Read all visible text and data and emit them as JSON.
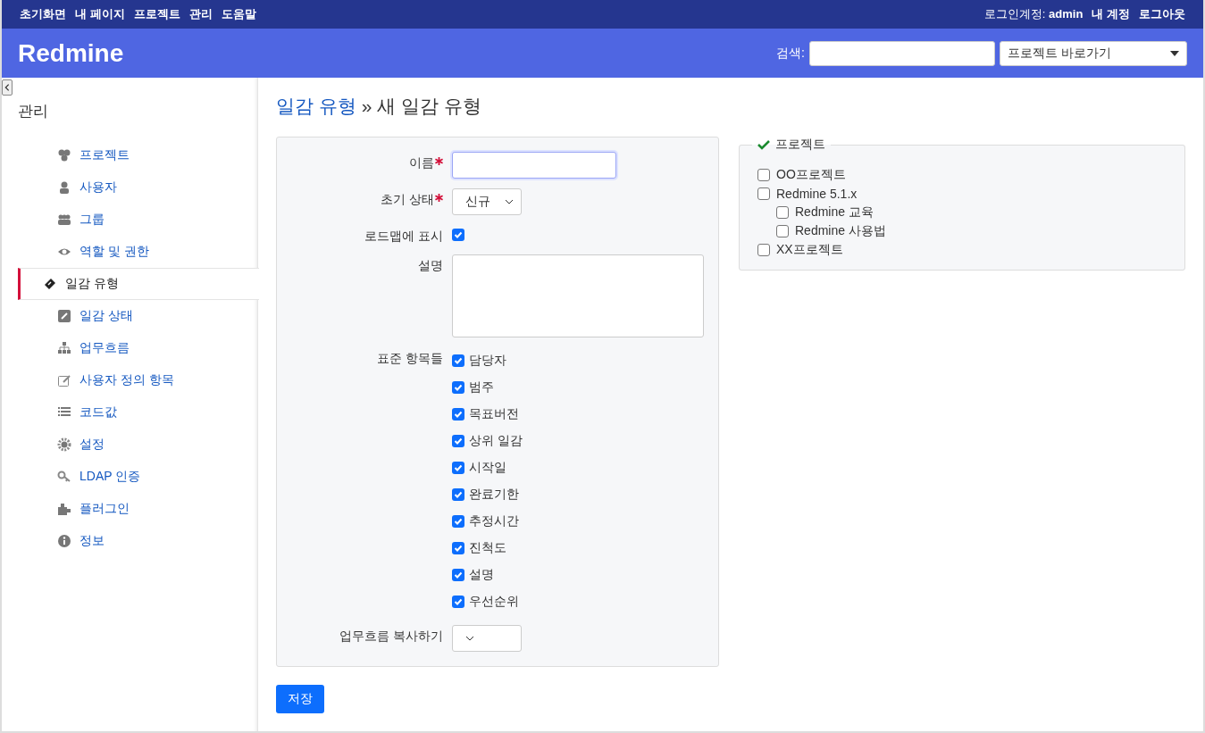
{
  "top_menu": {
    "items": [
      "초기화면",
      "내 페이지",
      "프로젝트",
      "관리",
      "도움말"
    ],
    "login_label": "로그인계정:",
    "login_user": "admin",
    "account_links": [
      "내 계정",
      "로그아웃"
    ]
  },
  "header": {
    "title": "Redmine",
    "search_label": "검색:",
    "project_jump": "프로젝트 바로가기"
  },
  "sidebar": {
    "title": "관리",
    "items": [
      {
        "label": "프로젝트",
        "selected": false
      },
      {
        "label": "사용자",
        "selected": false
      },
      {
        "label": "그룹",
        "selected": false
      },
      {
        "label": "역할 및 권한",
        "selected": false
      },
      {
        "label": "일감 유형",
        "selected": true
      },
      {
        "label": "일감 상태",
        "selected": false
      },
      {
        "label": "업무흐름",
        "selected": false
      },
      {
        "label": "사용자 정의 항목",
        "selected": false
      },
      {
        "label": "코드값",
        "selected": false
      },
      {
        "label": "설정",
        "selected": false
      },
      {
        "label": "LDAP 인증",
        "selected": false
      },
      {
        "label": "플러그인",
        "selected": false
      },
      {
        "label": "정보",
        "selected": false
      }
    ]
  },
  "breadcrumb": {
    "link": "일감 유형",
    "current": "» 새 일감 유형"
  },
  "form": {
    "fields": [
      {
        "kind": "text",
        "label": "이름",
        "required": true
      },
      {
        "kind": "select",
        "label": "초기 상태",
        "required": true,
        "value": "신규"
      },
      {
        "kind": "checkbox",
        "label": "로드맵에 표시",
        "required": false,
        "checked": true
      },
      {
        "kind": "textarea",
        "label": "설명",
        "required": false
      },
      {
        "kind": "checklist",
        "label": "표준 항목들",
        "required": false,
        "items": [
          {
            "label": "담당자",
            "checked": true
          },
          {
            "label": "범주",
            "checked": true
          },
          {
            "label": "목표버전",
            "checked": true
          },
          {
            "label": "상위 일감",
            "checked": true
          },
          {
            "label": "시작일",
            "checked": true
          },
          {
            "label": "완료기한",
            "checked": true
          },
          {
            "label": "추정시간",
            "checked": true
          },
          {
            "label": "진척도",
            "checked": true
          },
          {
            "label": "설명",
            "checked": true
          },
          {
            "label": "우선순위",
            "checked": true
          }
        ]
      },
      {
        "kind": "select",
        "label": "업무흐름 복사하기",
        "required": false
      }
    ]
  },
  "projects": {
    "legend": "프로젝트",
    "items": [
      {
        "label": "OO프로젝트",
        "checked": false
      },
      {
        "label": "Redmine 5.1.x",
        "checked": false,
        "children": [
          {
            "label": "Redmine 교육",
            "checked": false
          },
          {
            "label": "Redmine 사용법",
            "checked": false
          }
        ]
      },
      {
        "label": "XX프로젝트",
        "checked": false
      }
    ]
  },
  "save_button": "저장"
}
